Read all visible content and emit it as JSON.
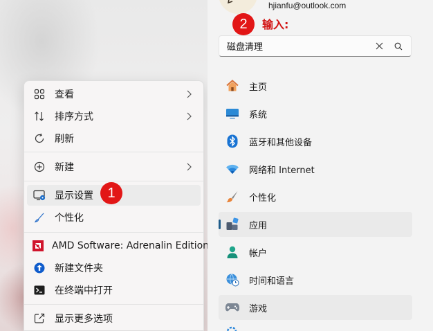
{
  "context_menu": {
    "items": [
      {
        "label": "查看",
        "icon": "grid-icon",
        "submenu": true
      },
      {
        "label": "排序方式",
        "icon": "sort-icon",
        "submenu": true
      },
      {
        "label": "刷新",
        "icon": "refresh-icon",
        "submenu": false
      },
      {
        "label": "新建",
        "icon": "add-circle-icon",
        "submenu": true
      },
      {
        "label": "显示设置",
        "icon": "display-settings-icon",
        "submenu": false
      },
      {
        "label": "个性化",
        "icon": "brush-icon",
        "submenu": false
      },
      {
        "label": "AMD Software: Adrenalin Edition",
        "icon": "amd-logo-icon",
        "submenu": false
      },
      {
        "label": "新建文件夹",
        "icon": "new-folder-icon",
        "submenu": false
      },
      {
        "label": "在终端中打开",
        "icon": "terminal-icon",
        "submenu": false
      },
      {
        "label": "显示更多选项",
        "icon": "more-options-icon",
        "submenu": false
      }
    ]
  },
  "annotations": {
    "step1": "1",
    "step2": "2",
    "input_hint": "输入:"
  },
  "settings": {
    "email": "hjianfu@outlook.com",
    "search_value": "磁盘清理",
    "nav": [
      {
        "label": "主页",
        "icon": "home-icon"
      },
      {
        "label": "系统",
        "icon": "system-icon"
      },
      {
        "label": "蓝牙和其他设备",
        "icon": "bluetooth-icon"
      },
      {
        "label": "网络和 Internet",
        "icon": "wifi-icon"
      },
      {
        "label": "个性化",
        "icon": "paintbrush-icon"
      },
      {
        "label": "应用",
        "icon": "apps-icon",
        "selected": true
      },
      {
        "label": "帐户",
        "icon": "account-icon"
      },
      {
        "label": "时间和语言",
        "icon": "globe-clock-icon"
      },
      {
        "label": "游戏",
        "icon": "gamepad-icon"
      }
    ]
  },
  "colors": {
    "badge": "#e21616",
    "accent": "#1f5c8a",
    "amd_red": "#d0142c",
    "win_blue": "#0067c0"
  }
}
